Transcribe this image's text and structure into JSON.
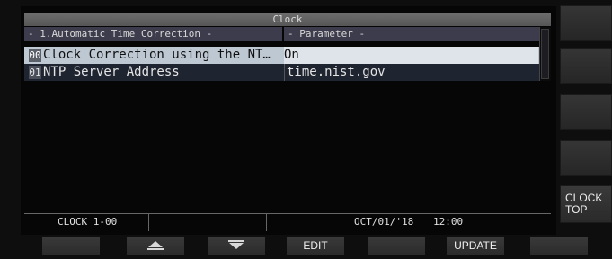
{
  "window": {
    "title": "Clock"
  },
  "columns": {
    "item_header": "- 1.Automatic Time Correction -",
    "param_header": "- Parameter -"
  },
  "rows": [
    {
      "index": "00",
      "label": "Clock Correction using the NT…",
      "value": "On",
      "selected": true
    },
    {
      "index": "01",
      "label": "NTP Server Address",
      "value": "time.nist.gov",
      "selected": false
    }
  ],
  "status": {
    "menu_id": "CLOCK 1-00",
    "date": "OCT/01/'18",
    "time": "12:00"
  },
  "side_keys": {
    "clock_top_label": "CLOCK\nTOP"
  },
  "bottom_keys": {
    "up_icon": "triangle-up-icon",
    "down_icon": "triangle-down-icon",
    "edit_label": "EDIT",
    "update_label": "UPDATE"
  },
  "colors": {
    "selected_row": "#bec8d3",
    "header_bar": "#3c3c4c",
    "background": "#060606"
  }
}
